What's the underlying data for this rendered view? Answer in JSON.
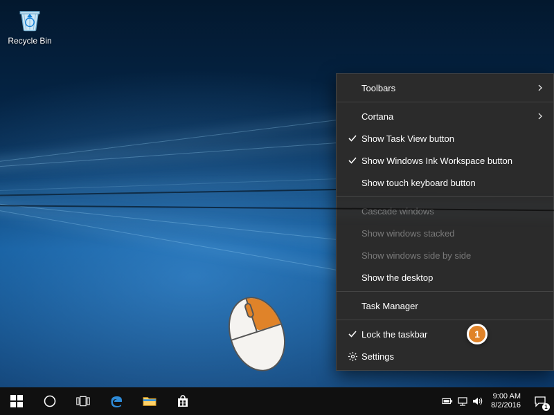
{
  "desktop": {
    "recycle_bin_label": "Recycle Bin"
  },
  "context_menu": {
    "items": [
      {
        "label": "Toolbars",
        "submenu": true
      },
      {
        "sep": true
      },
      {
        "label": "Cortana",
        "submenu": true
      },
      {
        "label": "Show Task View button",
        "checked": true
      },
      {
        "label": "Show Windows Ink Workspace button",
        "checked": true
      },
      {
        "label": "Show touch keyboard button"
      },
      {
        "sep": true
      },
      {
        "label": "Cascade windows",
        "disabled": true
      },
      {
        "label": "Show windows stacked",
        "disabled": true
      },
      {
        "label": "Show windows side by side",
        "disabled": true
      },
      {
        "label": "Show the desktop"
      },
      {
        "sep": true
      },
      {
        "label": "Task Manager"
      },
      {
        "sep": true
      },
      {
        "label": "Lock the taskbar",
        "checked": true
      },
      {
        "label": "Settings",
        "icon": "gear"
      }
    ]
  },
  "taskbar": {
    "buttons": [
      "start",
      "cortana",
      "task-view",
      "edge",
      "file-explorer",
      "store"
    ]
  },
  "tray": {
    "time": "9:00 AM",
    "date": "8/2/2016",
    "badge": "1"
  },
  "callouts": {
    "a": "1",
    "b": "1"
  }
}
